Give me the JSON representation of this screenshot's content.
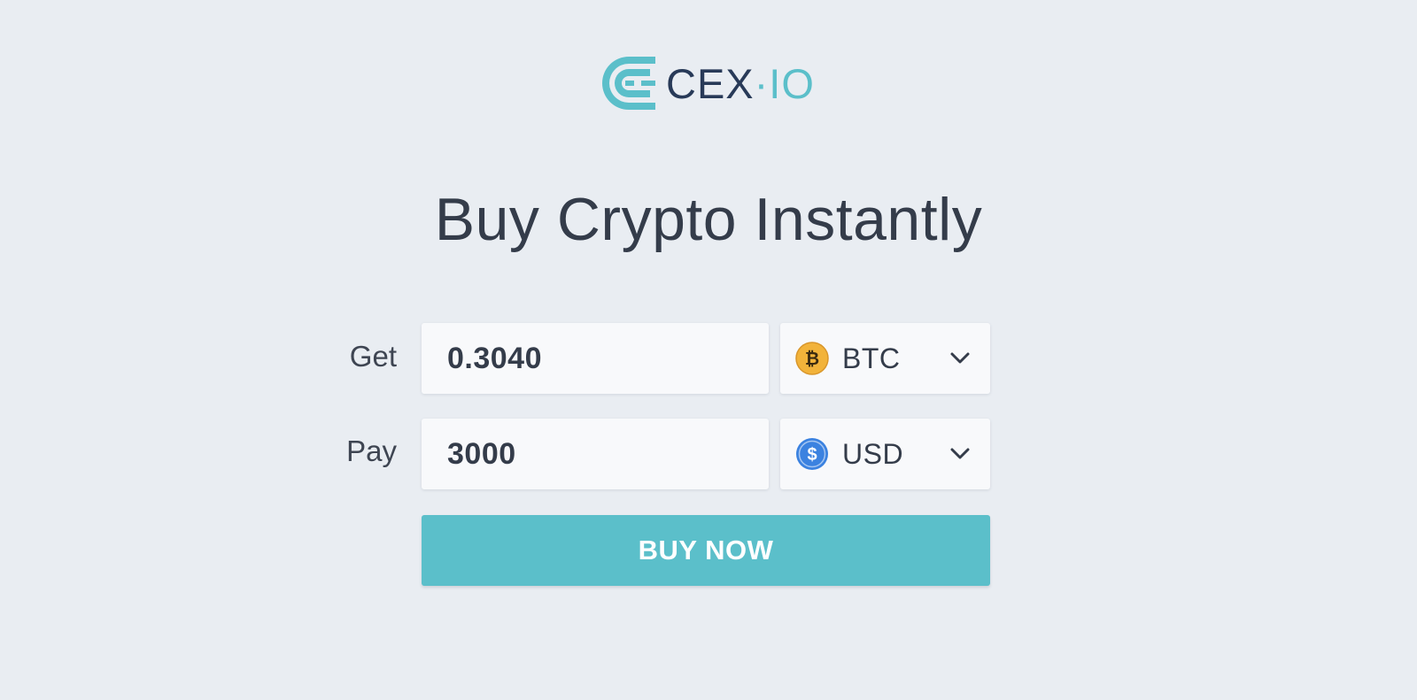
{
  "logo": {
    "text_main": "CEX",
    "text_dot": "·",
    "text_suffix": "IO",
    "colors": {
      "dark": "#283a58",
      "accent": "#5bbfca"
    }
  },
  "heading": "Buy Crypto Instantly",
  "form": {
    "get": {
      "label": "Get",
      "amount": "0.3040",
      "currency": {
        "code": "BTC",
        "icon": "bitcoin-icon",
        "icon_color": "#f2b33a"
      }
    },
    "pay": {
      "label": "Pay",
      "amount": "3000",
      "currency": {
        "code": "USD",
        "icon": "dollar-icon",
        "icon_color": "#3b82e0"
      }
    }
  },
  "buy_button": {
    "label": "BUY NOW",
    "color": "#5bbfca"
  }
}
